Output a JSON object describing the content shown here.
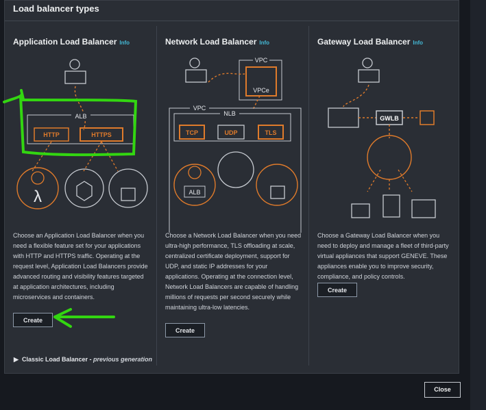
{
  "modal": {
    "title": "Load balancer types",
    "info_label": "Info",
    "cards": [
      {
        "title": "Application Load Balancer",
        "description": "Choose an Application Load Balancer when you need a flexible feature set for your applications with HTTP and HTTPS traffic. Operating at the request level, Application Load Balancers provide advanced routing and visibility features targeted at application architectures, including microservices and containers.",
        "create_label": "Create",
        "diagram": {
          "group": "ALB",
          "protocols": [
            "HTTP",
            "HTTPS"
          ]
        }
      },
      {
        "title": "Network Load Balancer",
        "description": "Choose a Network Load Balancer when you need ultra-high performance, TLS offloading at scale, centralized certificate deployment, support for UDP, and static IP addresses for your applications. Operating at the connection level, Network Load Balancers are capable of handling millions of requests per second securely while maintaining ultra-low latencies.",
        "create_label": "Create",
        "diagram": {
          "vpc_top": "VPC",
          "vpce": "VPCe",
          "vpc_left": "VPC",
          "group": "NLB",
          "protocols": [
            "TCP",
            "UDP",
            "TLS"
          ],
          "target": "ALB"
        }
      },
      {
        "title": "Gateway Load Balancer",
        "description": "Choose a Gateway Load Balancer when you need to deploy and manage a fleet of third-party virtual appliances that support GENEVE. These appliances enable you to improve security, compliance, and policy controls.",
        "create_label": "Create",
        "diagram": {
          "group": "GWLB"
        }
      }
    ],
    "classic": {
      "label": "Classic Load Balancer",
      "sep": " - ",
      "suffix": "previous generation"
    },
    "close_label": "Close"
  },
  "colors": {
    "orange": "#e07b2b",
    "accent_link": "#44b9d6",
    "annotation_green": "#33d611"
  }
}
